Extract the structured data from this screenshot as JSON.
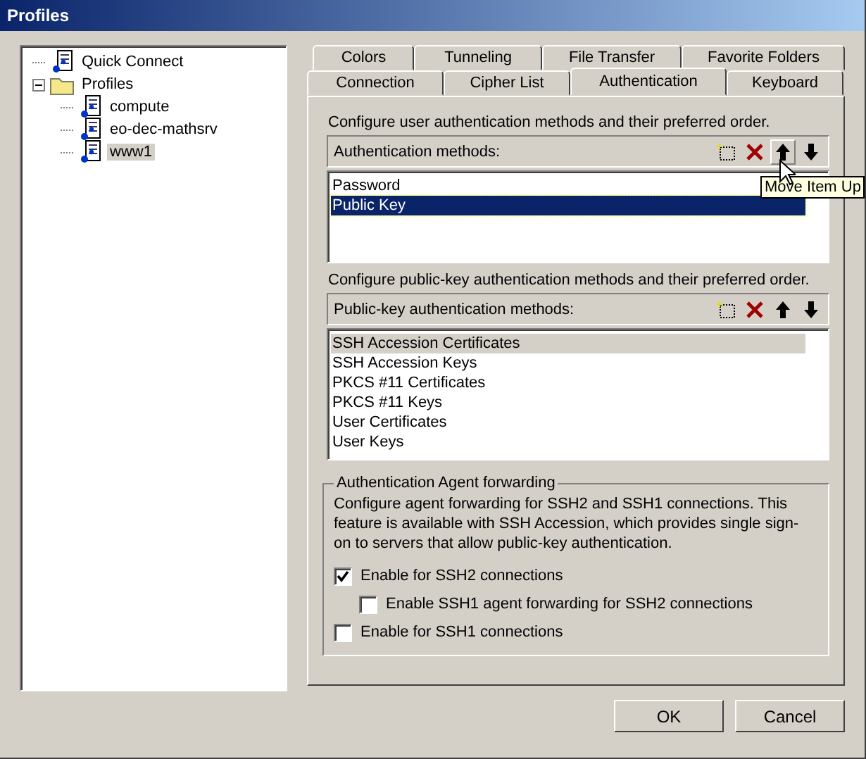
{
  "window": {
    "title": "Profiles"
  },
  "tree": [
    {
      "label": "Quick Connect",
      "kind": "profile",
      "selected": false
    },
    {
      "label": "Profiles",
      "kind": "folder",
      "expanded": true,
      "selected": false,
      "children": [
        {
          "label": "compute",
          "kind": "profile",
          "selected": false
        },
        {
          "label": "eo-dec-mathsrv",
          "kind": "profile",
          "selected": false
        },
        {
          "label": "www1",
          "kind": "profile",
          "selected": true
        }
      ]
    }
  ],
  "tabs_back": [
    {
      "label": "Colors",
      "selected": false
    },
    {
      "label": "Tunneling",
      "selected": false
    },
    {
      "label": "File Transfer",
      "selected": false
    },
    {
      "label": "Favorite Folders",
      "selected": false
    }
  ],
  "tabs_front": [
    {
      "label": "Connection",
      "selected": false
    },
    {
      "label": "Cipher List",
      "selected": false
    },
    {
      "label": "Authentication",
      "selected": true
    },
    {
      "label": "Keyboard",
      "selected": false
    }
  ],
  "auth": {
    "description": "Configure user authentication methods and their preferred order.",
    "header": "Authentication methods:",
    "tools": [
      {
        "kind": "new",
        "hovered": false
      },
      {
        "kind": "delete",
        "hovered": false
      },
      {
        "kind": "up",
        "hovered": true
      },
      {
        "kind": "down",
        "hovered": false
      }
    ],
    "items": [
      {
        "label": "Password",
        "selected": false
      },
      {
        "label": "Public Key",
        "selected": true
      }
    ]
  },
  "tooltip": "Move Item Up",
  "pubkey": {
    "description": "Configure public-key authentication methods and their preferred order.",
    "header": "Public-key authentication methods:",
    "tools": [
      {
        "kind": "new",
        "hovered": false
      },
      {
        "kind": "delete",
        "hovered": false
      },
      {
        "kind": "up",
        "hovered": false
      },
      {
        "kind": "down",
        "hovered": false
      }
    ],
    "items": [
      {
        "label": "SSH Accession Certificates",
        "selected": true
      },
      {
        "label": "SSH Accession Keys",
        "selected": false
      },
      {
        "label": "PKCS #11 Certificates",
        "selected": false
      },
      {
        "label": "PKCS #11 Keys",
        "selected": false
      },
      {
        "label": "User Certificates",
        "selected": false
      },
      {
        "label": "User Keys",
        "selected": false
      }
    ]
  },
  "agent": {
    "title": "Authentication Agent forwarding",
    "description": "Configure agent forwarding for SSH2 and SSH1 connections. This feature is available with SSH Accession, which provides single sign-on to servers that allow public-key authentication.",
    "options": [
      {
        "label": "Enable for SSH2 connections",
        "checked": true,
        "children": [
          {
            "label": "Enable SSH1 agent forwarding for SSH2 connections",
            "checked": false
          }
        ]
      },
      {
        "label": "Enable for SSH1 connections",
        "checked": false
      }
    ]
  },
  "buttons": [
    "OK",
    "Cancel"
  ]
}
